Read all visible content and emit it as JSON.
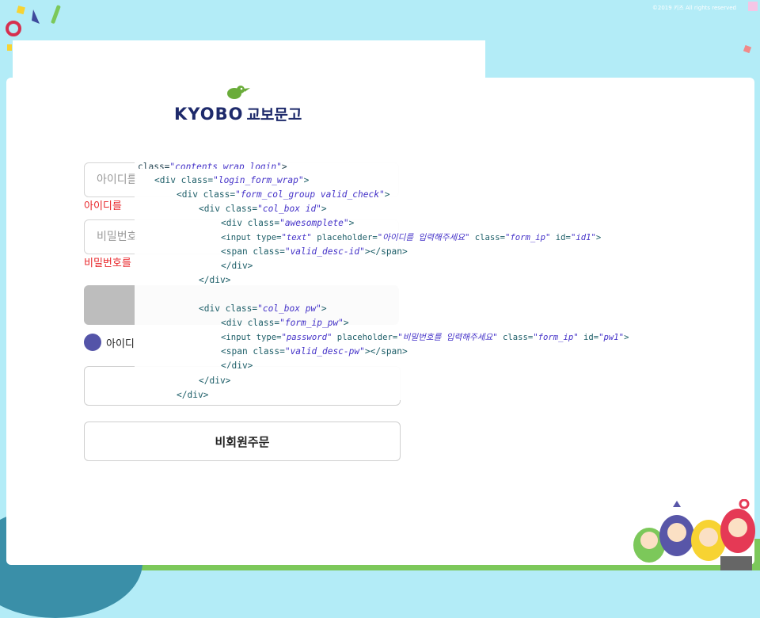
{
  "footer": {
    "copyright": "©2019 키즈 All rights reserved"
  },
  "logo": {
    "brand_en": "KYOBO",
    "brand_kr": "교보문고"
  },
  "login": {
    "id_placeholder": "아이디를",
    "id_error": "아이디를 ",
    "pw_placeholder": "비밀번호",
    "pw_error": "비밀번호를",
    "save_id_label": "아이디",
    "guest_order_label": "비회원주문"
  },
  "devtools": {
    "lines": [
      "class=\"contents_wrap_login\">",
      "<div class=\"login_form_wrap\">",
      "<div class=\"form_col_group valid_check\">",
      "<div class=\"col_box id\">",
      "<div class=\"awesomplete\">",
      "<input type=\"text\" placeholder=\"아이디를 입력해주세요\" class=\"form_ip\" id=\"id1\">",
      "<span class=\"valid_desc-id\"></span>",
      "</div>",
      "</div>",
      "<div class=\"col_box pw\">",
      "<div class=\"form_ip_pw\">",
      "<input type=\"password\" placeholder=\"비밀번호를 입력해주세요\" class=\"form_ip\" id=\"pw1\">",
      "<span class=\"valid_desc-pw\"></span>",
      "</div>",
      "</div>",
      "</div>"
    ]
  },
  "colors": {
    "background": "#b3ecf7",
    "brand_navy": "#1e2a6b",
    "brand_green": "#6aac3a",
    "error": "#e8262a",
    "toggle": "#5454a8"
  }
}
